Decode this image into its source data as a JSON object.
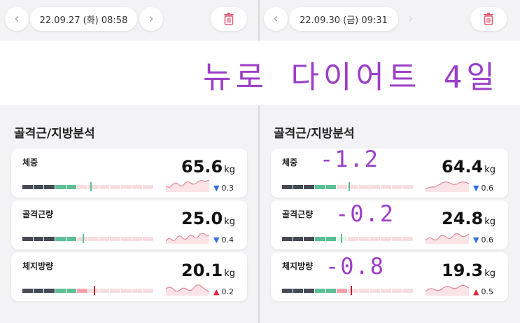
{
  "left": {
    "date": "22.09.27 (화) 08:58",
    "section_title": "골격근/지방분석",
    "cards": [
      {
        "label": "체중",
        "value": "65.6",
        "unit": "kg",
        "delta": "0.3",
        "direction": "down"
      },
      {
        "label": "골격근량",
        "value": "25.0",
        "unit": "kg",
        "delta": "0.4",
        "direction": "down"
      },
      {
        "label": "체지방량",
        "value": "20.1",
        "unit": "kg",
        "delta": "0.2",
        "direction": "up"
      }
    ]
  },
  "right": {
    "date": "22.09.30 (금) 09:31",
    "section_title": "골격근/지방분석",
    "cards": [
      {
        "label": "체중",
        "value": "64.4",
        "unit": "kg",
        "delta": "0.6",
        "direction": "down",
        "note": "-1.2"
      },
      {
        "label": "골격근량",
        "value": "24.8",
        "unit": "kg",
        "delta": "0.6",
        "direction": "down",
        "note": "-0.2"
      },
      {
        "label": "체지방량",
        "value": "19.3",
        "unit": "kg",
        "delta": "0.5",
        "direction": "up",
        "note": "-0.8"
      }
    ]
  },
  "banner": {
    "text": "뉴로 다이어트 4일"
  },
  "icons": {
    "prev": "chevron-left-icon",
    "next": "chevron-right-icon",
    "delete": "trash-icon",
    "down": "triangle-down-icon",
    "up": "triangle-up-icon"
  },
  "colors": {
    "accent": "#9b3fc8",
    "gauge_dark": "#464a55",
    "gauge_green": "#5cbf97",
    "gauge_pink": "#f7dde1",
    "down": "#2f6fe0",
    "up": "#d8263a",
    "trash": "#e0607a"
  }
}
